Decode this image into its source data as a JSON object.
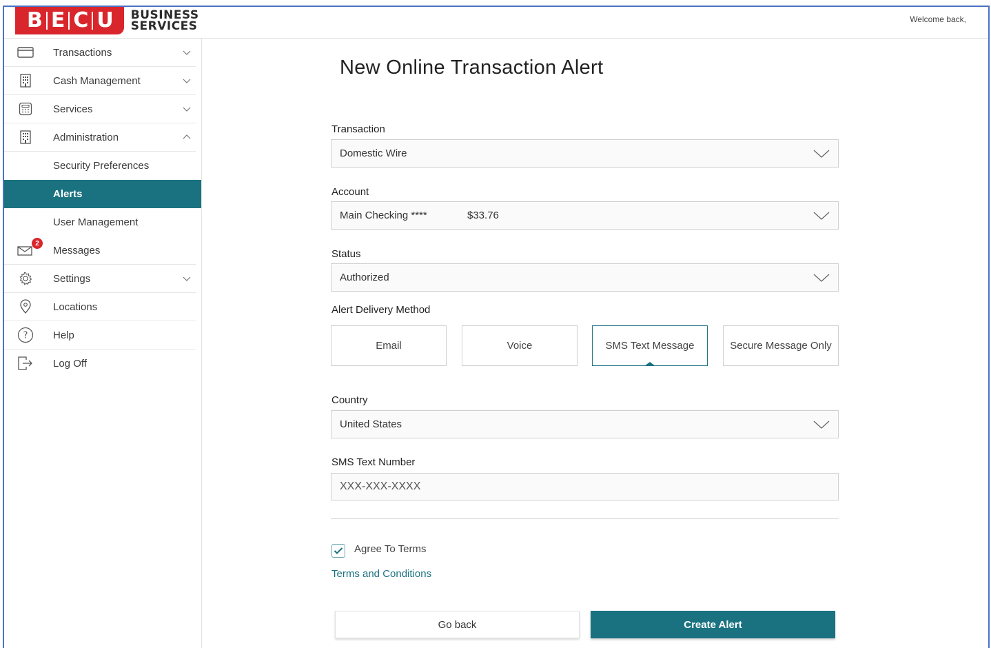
{
  "brand": {
    "letters": [
      "B",
      "E",
      "C",
      "U"
    ],
    "line1": "BUSINESS",
    "line2": "SERVICES",
    "color": "#d9262c"
  },
  "header": {
    "welcome": "Welcome back,"
  },
  "sidebar": {
    "items": [
      {
        "label": "Transactions",
        "icon": "card-icon",
        "chevron": "down"
      },
      {
        "label": "Cash Management",
        "icon": "building-icon",
        "chevron": "down"
      },
      {
        "label": "Services",
        "icon": "calculator-icon",
        "chevron": "down"
      },
      {
        "label": "Administration",
        "icon": "building-icon",
        "chevron": "up"
      },
      {
        "label": "Security Preferences",
        "sub": true
      },
      {
        "label": "Alerts",
        "sub": true,
        "active": true
      },
      {
        "label": "User Management",
        "sub": true
      },
      {
        "label": "Messages",
        "icon": "mail-icon",
        "badge": "2"
      },
      {
        "label": "Settings",
        "icon": "gear-icon",
        "chevron": "down"
      },
      {
        "label": "Locations",
        "icon": "map-pin-icon"
      },
      {
        "label": "Help",
        "icon": "help-icon"
      },
      {
        "label": "Log Off",
        "icon": "logout-icon"
      }
    ],
    "active_color": "#1a7281"
  },
  "form": {
    "title": "New Online Transaction Alert",
    "transaction": {
      "label": "Transaction",
      "value": "Domestic Wire"
    },
    "account": {
      "label": "Account",
      "value": "Main Checking ****",
      "amount": "$33.76"
    },
    "status": {
      "label": "Status",
      "value": "Authorized"
    },
    "delivery": {
      "label": "Alert Delivery Method",
      "options": [
        "Email",
        "Voice",
        "SMS Text Message",
        "Secure Message Only"
      ],
      "selected": "SMS Text Message"
    },
    "country": {
      "label": "Country",
      "value": "United States"
    },
    "sms": {
      "label": "SMS Text Number",
      "placeholder": "XXX-XXX-XXXX"
    },
    "agree": {
      "label": "Agree To Terms",
      "checked": true
    },
    "terms_link": "Terms and Conditions",
    "buttons": {
      "back": "Go back",
      "create": "Create Alert"
    }
  }
}
